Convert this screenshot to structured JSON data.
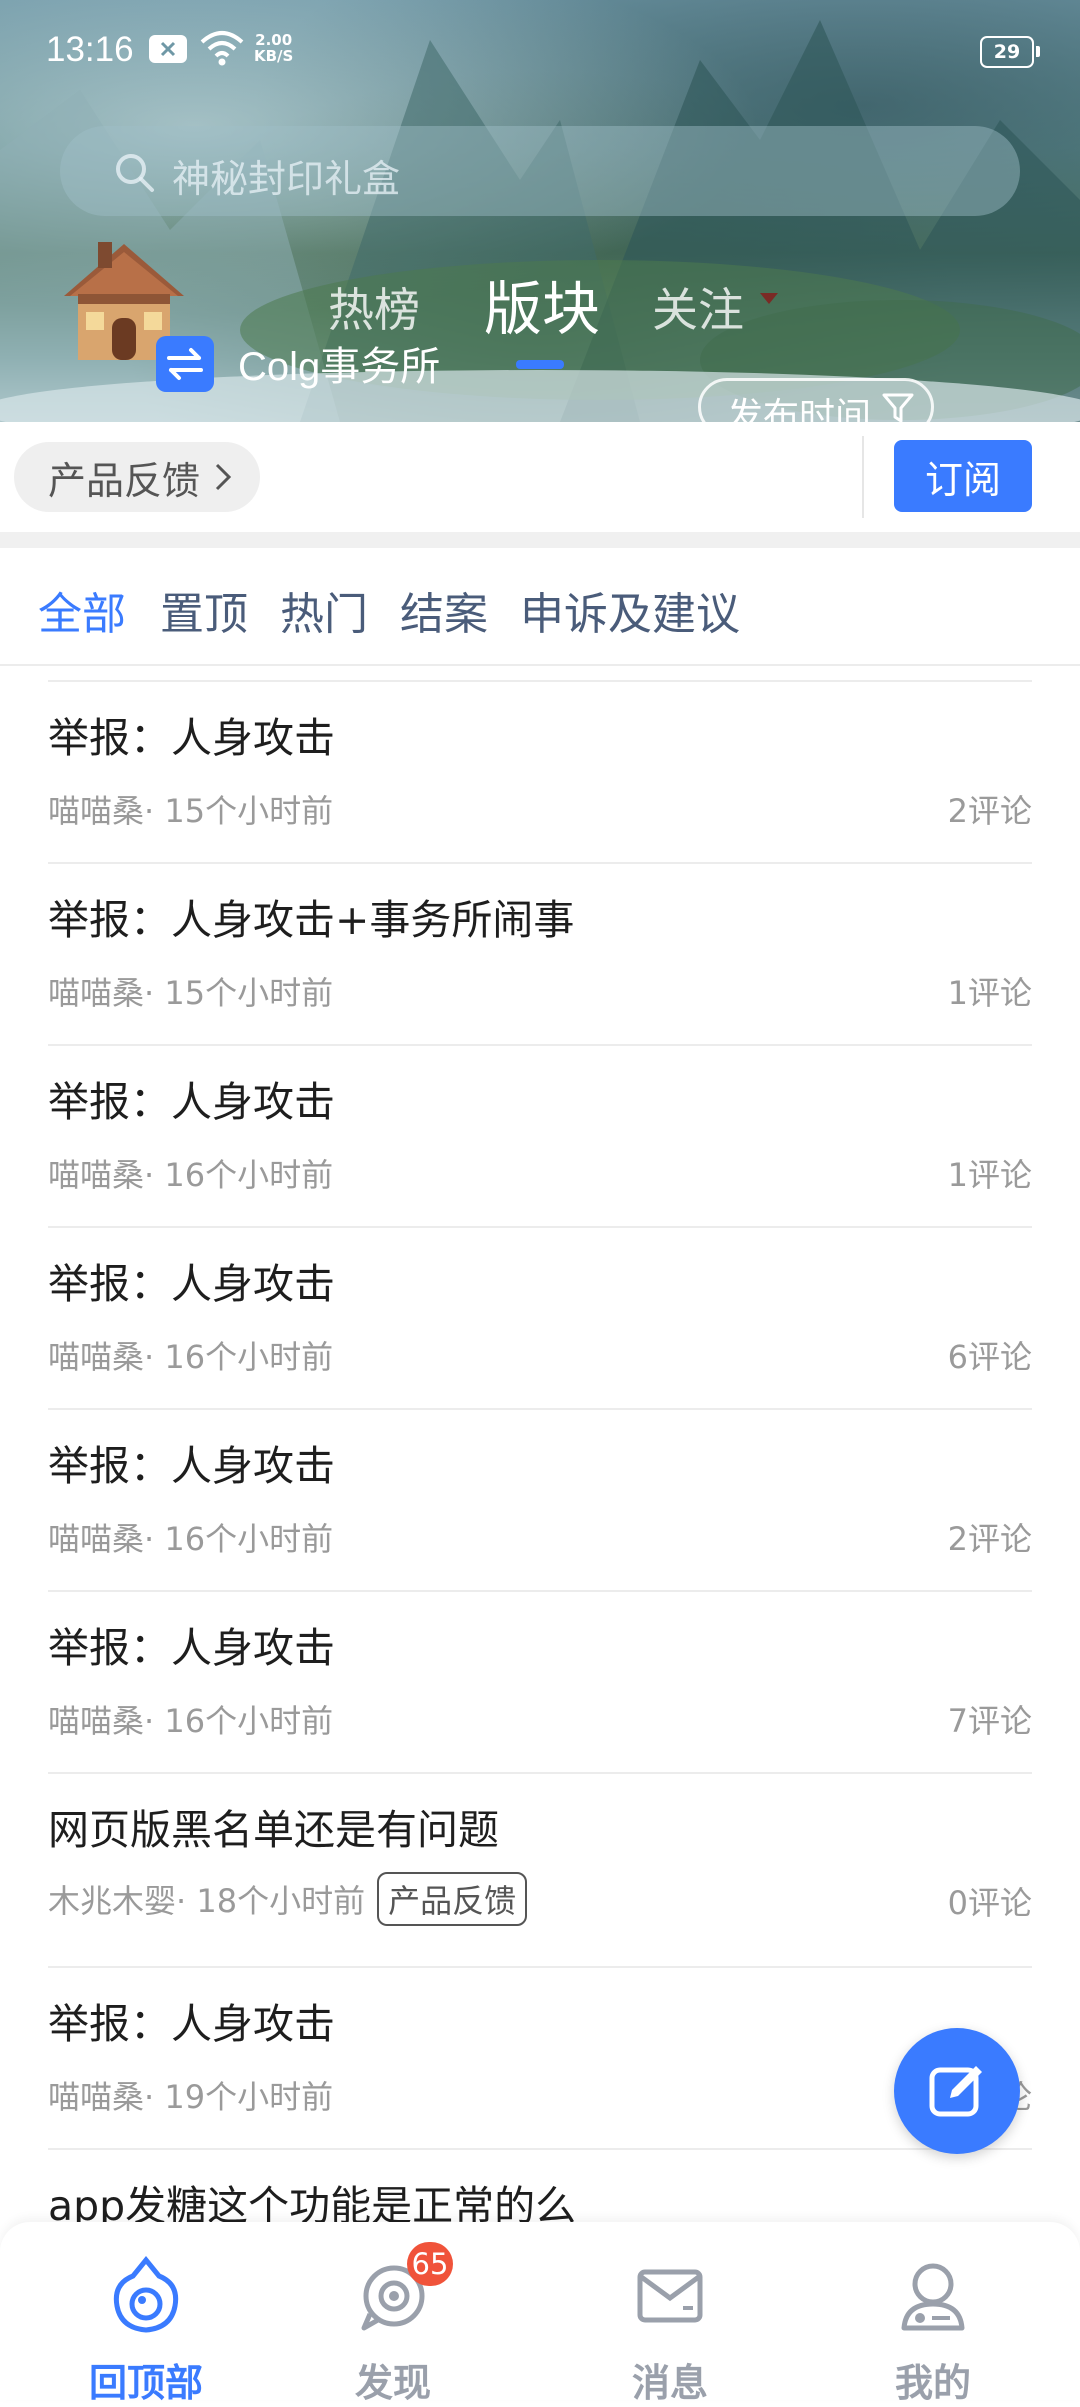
{
  "status_bar": {
    "time": "13:16",
    "net_speed_value": "2.00",
    "net_speed_unit": "KB/S",
    "battery": "29"
  },
  "search": {
    "placeholder": "神秘封印礼盒"
  },
  "forum": {
    "name": "Colg事务所"
  },
  "header_tabs": {
    "hot": "热榜",
    "board": "版块",
    "follow": "关注"
  },
  "sort_button": "发布时间",
  "sub_forum": {
    "chip_label": "产品反馈",
    "subscribe_label": "订阅"
  },
  "categories": [
    "全部",
    "置顶",
    "热门",
    "结案",
    "申诉及建议"
  ],
  "posts": [
    {
      "title": "举报：人身攻击",
      "author": "喵喵桑",
      "time": "· 15个小时前",
      "tag": "",
      "comments": "2评论"
    },
    {
      "title": "举报：人身攻击+事务所闹事",
      "author": "喵喵桑",
      "time": "· 15个小时前",
      "tag": "",
      "comments": "1评论"
    },
    {
      "title": "举报：人身攻击",
      "author": "喵喵桑",
      "time": "· 16个小时前",
      "tag": "",
      "comments": "1评论"
    },
    {
      "title": "举报：人身攻击",
      "author": "喵喵桑",
      "time": "· 16个小时前",
      "tag": "",
      "comments": "6评论"
    },
    {
      "title": "举报：人身攻击",
      "author": "喵喵桑",
      "time": "· 16个小时前",
      "tag": "",
      "comments": "2评论"
    },
    {
      "title": "举报：人身攻击",
      "author": "喵喵桑",
      "time": "· 16个小时前",
      "tag": "",
      "comments": "7评论"
    },
    {
      "title": "网页版黑名单还是有问题",
      "author": "木兆木婴",
      "time": " · 18个小时前",
      "tag": "产品反馈",
      "comments": "0评论"
    },
    {
      "title": "举报：人身攻击",
      "author": "喵喵桑",
      "time": "· 19个小时前",
      "tag": "",
      "comments": "论"
    },
    {
      "title": "app发糖这个功能是正常的么",
      "author": "",
      "time": "",
      "tag": "",
      "comments": ""
    }
  ],
  "bottom_nav": [
    {
      "label": "回顶部",
      "icon": "back-to-top-icon",
      "active": true
    },
    {
      "label": "发现",
      "icon": "discover-icon",
      "badge": "65"
    },
    {
      "label": "消息",
      "icon": "mail-icon"
    },
    {
      "label": "我的",
      "icon": "profile-icon"
    }
  ],
  "colors": {
    "accent": "#3a7bff",
    "badge": "#f0533a",
    "category_text": "#4a5c7a",
    "muted_text": "#9a9a9a"
  }
}
